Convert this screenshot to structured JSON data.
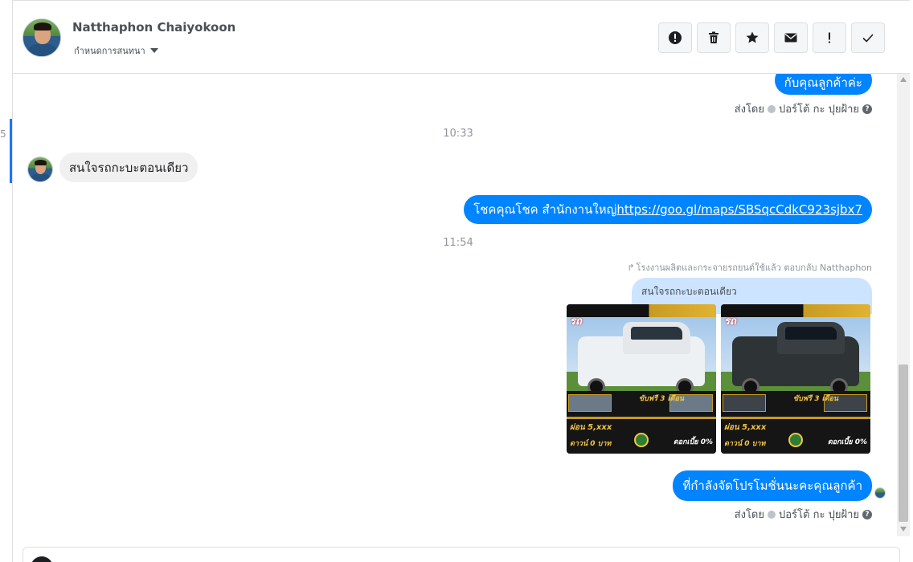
{
  "list_edge": {
    "digit": "5"
  },
  "header": {
    "name": "Natthaphon Chaiyokoon",
    "subtitle": "กำหนดการสนทนา",
    "actions": [
      {
        "name": "report-spam-button",
        "icon": "alert-circle-icon"
      },
      {
        "name": "delete-button",
        "icon": "trash-icon"
      },
      {
        "name": "star-button",
        "icon": "star-icon"
      },
      {
        "name": "mark-unread-button",
        "icon": "envelope-icon"
      },
      {
        "name": "mark-important-button",
        "icon": "exclamation-icon"
      },
      {
        "name": "mark-done-button",
        "icon": "check-icon"
      }
    ]
  },
  "messages": {
    "m1_text": "กับคุณลูกค้าค่ะ",
    "m1_sent_prefix": "ส่งโดย",
    "m1_sent_name": "ปอร์โต้ กะ ปุยฝ้าย",
    "time1": "10:33",
    "m2_text": "สนใจรถกะบะตอนเดียว",
    "m3_text_prefix": "โชคคุณโชค สำนักงานใหญ่ ",
    "m3_link": "https://goo.gl/maps/SBSqcCdkC923sjbx7",
    "time2": "11:54",
    "reply_note": "โรงงานผลิตและกระจายรถยนต์ใช้แล้ว ตอบกลับ Natthaphon",
    "quote": "สนใจรถกะบะตอนเดียว",
    "photo1": {
      "badge": "รถ",
      "promo": "ขับฟรี 3 เดือน",
      "price": "ผ่อน 5,xxx",
      "down": "ดาวน์ 0 บาท",
      "rate": "ดอกเบี้ย 0%"
    },
    "photo2": {
      "badge": "รถ",
      "promo": "ขับฟรี 3 เดือน",
      "price": "ผ่อน 5,xxx",
      "down": "ดาวน์ 0 บาท",
      "rate": "ดอกเบี้ย 0%"
    },
    "m4_text": "ที่กำลังจัดโปรโมชั่นนะคะคุณลูกค้า",
    "m4_sent_prefix": "ส่งโดย",
    "m4_sent_name": "ปอร์โต้ กะ ปุยฝ้าย"
  },
  "colors": {
    "outgoing": "#0084ff",
    "incoming": "#f1f0f0",
    "quote": "#cce4ff",
    "selection": "#1877f2"
  }
}
